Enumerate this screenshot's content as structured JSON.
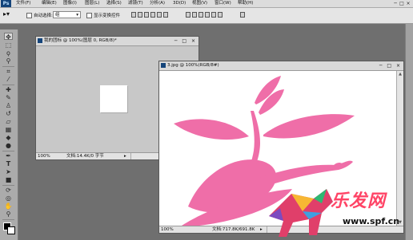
{
  "app": {
    "logo": "Ps"
  },
  "menu": [
    "文件(F)",
    "编辑(E)",
    "图像(I)",
    "图层(L)",
    "选择(S)",
    "滤镜(T)",
    "分析(A)",
    "3D(D)",
    "视图(V)",
    "窗口(W)",
    "帮助(H)"
  ],
  "window_controls": {
    "minimize": "─",
    "maximize": "□",
    "close": "×"
  },
  "options": {
    "auto_select_label": "自动选择:",
    "auto_select_value": "组",
    "show_transform_label": "显示变换控件"
  },
  "doc1": {
    "title": "我的团标 @ 100%(图层 0, RGB/8)*",
    "zoom": "100%",
    "info": "文档:14.4K/0 字节",
    "controls": "─ □ ×"
  },
  "doc2": {
    "title": "3.jpg @ 100%(RGB/8#)",
    "zoom": "100%",
    "info": "文档:717.8K/691.8K",
    "controls": "─ □ ×"
  },
  "watermark": {
    "text": "乐发网",
    "url": "www.spf.cn"
  },
  "colors": {
    "flower": "#ef6ea8",
    "canvas_bg": "#ffffff",
    "workspace": "#6f6f6f"
  },
  "icons": [
    "move-tool-icon",
    "marquee-tool-icon",
    "lasso-tool-icon",
    "magic-wand-tool-icon",
    "crop-tool-icon",
    "eyedropper-tool-icon",
    "healing-brush-tool-icon",
    "brush-tool-icon",
    "clone-stamp-tool-icon",
    "history-brush-tool-icon",
    "eraser-tool-icon",
    "gradient-tool-icon",
    "blur-tool-icon",
    "dodge-tool-icon",
    "pen-tool-icon",
    "type-tool-icon",
    "path-select-tool-icon",
    "shape-tool-icon",
    "3d-rotate-tool-icon",
    "3d-orbit-tool-icon",
    "hand-tool-icon",
    "zoom-tool-icon"
  ]
}
